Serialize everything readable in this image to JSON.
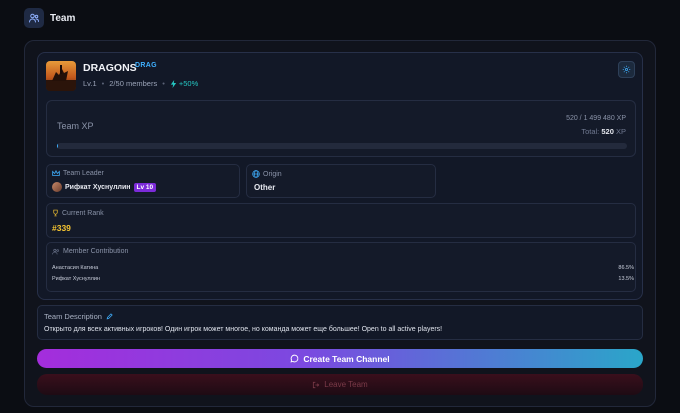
{
  "header": {
    "title": "Team",
    "icon": "users-icon"
  },
  "team": {
    "name": "DRAGONS",
    "tag": "DRAG",
    "level": "Lv.1",
    "members": "2/50 members",
    "boost": "+50%"
  },
  "xp": {
    "title": "Team XP",
    "value": "520 / 1 499 480 XP",
    "total_label": "Total:",
    "total_value": "520",
    "total_unit": "XP",
    "progress": 0.0003
  },
  "leader": {
    "label": "Team Leader",
    "name": "Рифкат Хуснуллин",
    "level": "Lv 10"
  },
  "origin": {
    "label": "Origin",
    "value": "Other"
  },
  "rank": {
    "label": "Current Rank",
    "value": "#339"
  },
  "contribution": {
    "label": "Member Contribution",
    "members": [
      {
        "name": "Анастасия Катина",
        "percent": "86.5%"
      },
      {
        "name": "Рифкат Хуснуллин",
        "percent": "13.5%"
      }
    ]
  },
  "description": {
    "title": "Team Description",
    "text": "Открыто для всех активных игроков! Один игрок может многое, но команда может еще большее! Open to all active players!"
  },
  "actions": {
    "create_channel": "Create Team Channel",
    "leave_team": "Leave Team"
  },
  "colors": {
    "accent_blue": "#3fb0ff",
    "level_badge": "#7c2bd9",
    "rank_gold": "#f5c431",
    "boost_teal": "#25c7c3"
  }
}
